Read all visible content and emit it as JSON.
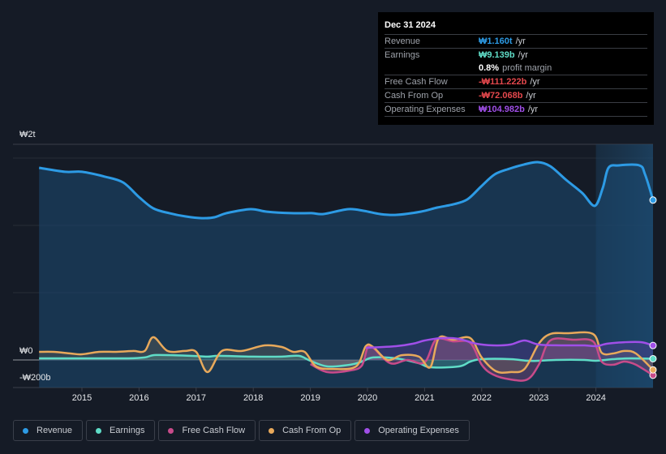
{
  "tooltip": {
    "date": "Dec 31 2024",
    "rows": [
      {
        "label": "Revenue",
        "value": "₩1.160t",
        "unit": "/yr",
        "color": "#2d9be5"
      },
      {
        "label": "Earnings",
        "value": "₩9.139b",
        "unit": "/yr",
        "color": "#5fdcc7"
      },
      {
        "label": "",
        "value": "0.8%",
        "unit": "profit margin",
        "color": "#ffffff"
      },
      {
        "label": "Free Cash Flow",
        "value": "-₩111.222b",
        "unit": "/yr",
        "color": "#e5484d"
      },
      {
        "label": "Cash From Op",
        "value": "-₩72.068b",
        "unit": "/yr",
        "color": "#e5484d"
      },
      {
        "label": "Operating Expenses",
        "value": "₩104.982b",
        "unit": "/yr",
        "color": "#a04fe8"
      }
    ]
  },
  "legend": [
    {
      "label": "Revenue",
      "color": "#2d9be5"
    },
    {
      "label": "Earnings",
      "color": "#5fdcc7"
    },
    {
      "label": "Free Cash Flow",
      "color": "#c84b8a"
    },
    {
      "label": "Cash From Op",
      "color": "#e8a95b"
    },
    {
      "label": "Operating Expenses",
      "color": "#a04fe8"
    }
  ],
  "chart_data": {
    "type": "line",
    "title": "",
    "xlabel": "",
    "ylabel": "",
    "units": "KRW billions",
    "y_tick_labels": [
      "₩2t",
      "₩0",
      "-₩200b"
    ],
    "x_tick_labels": [
      "2015",
      "2016",
      "2017",
      "2018",
      "2019",
      "2020",
      "2021",
      "2022",
      "2023",
      "2024"
    ],
    "xlim": [
      2014.25,
      2025.0
    ],
    "forecast_shade_from": 2024.0,
    "series": [
      {
        "name": "Revenue",
        "color": "#2d9be5",
        "points": [
          [
            2014.25,
            1394
          ],
          [
            2014.7,
            1365
          ],
          [
            2015.0,
            1365
          ],
          [
            2015.4,
            1330
          ],
          [
            2015.72,
            1288
          ],
          [
            2016.0,
            1182
          ],
          [
            2016.25,
            1100
          ],
          [
            2016.53,
            1065
          ],
          [
            2016.82,
            1041
          ],
          [
            2017.1,
            1029
          ],
          [
            2017.32,
            1035
          ],
          [
            2017.53,
            1065
          ],
          [
            2017.95,
            1094
          ],
          [
            2018.24,
            1076
          ],
          [
            2018.66,
            1065
          ],
          [
            2019.02,
            1065
          ],
          [
            2019.23,
            1059
          ],
          [
            2019.66,
            1094
          ],
          [
            2019.94,
            1082
          ],
          [
            2020.22,
            1059
          ],
          [
            2020.51,
            1053
          ],
          [
            2020.93,
            1076
          ],
          [
            2021.22,
            1106
          ],
          [
            2021.5,
            1129
          ],
          [
            2021.75,
            1165
          ],
          [
            2021.99,
            1259
          ],
          [
            2022.23,
            1347
          ],
          [
            2022.49,
            1388
          ],
          [
            2022.74,
            1418
          ],
          [
            2022.98,
            1435
          ],
          [
            2023.2,
            1406
          ],
          [
            2023.48,
            1306
          ],
          [
            2023.76,
            1212
          ],
          [
            2023.98,
            1118
          ],
          [
            2024.12,
            1247
          ],
          [
            2024.22,
            1394
          ],
          [
            2024.4,
            1412
          ],
          [
            2024.76,
            1412
          ],
          [
            2024.86,
            1347
          ],
          [
            2025.0,
            1160
          ]
        ]
      },
      {
        "name": "Earnings",
        "color": "#5fdcc7",
        "points": [
          [
            2014.25,
            12
          ],
          [
            2015.0,
            12
          ],
          [
            2015.8,
            12
          ],
          [
            2016.1,
            18
          ],
          [
            2016.3,
            36
          ],
          [
            2016.9,
            30
          ],
          [
            2017.2,
            24
          ],
          [
            2017.4,
            30
          ],
          [
            2018.0,
            24
          ],
          [
            2018.5,
            24
          ],
          [
            2018.8,
            30
          ],
          [
            2019.0,
            -6
          ],
          [
            2019.3,
            -47
          ],
          [
            2019.7,
            -35
          ],
          [
            2019.9,
            -12
          ],
          [
            2020.1,
            18
          ],
          [
            2020.5,
            12
          ],
          [
            2020.9,
            -24
          ],
          [
            2021.1,
            -53
          ],
          [
            2021.6,
            -47
          ],
          [
            2021.8,
            -12
          ],
          [
            2022.0,
            6
          ],
          [
            2022.5,
            6
          ],
          [
            2022.8,
            -6
          ],
          [
            2023.0,
            -6
          ],
          [
            2023.3,
            0
          ],
          [
            2023.8,
            0
          ],
          [
            2024.0,
            -6
          ],
          [
            2024.3,
            6
          ],
          [
            2024.6,
            12
          ],
          [
            2025.0,
            9
          ]
        ]
      },
      {
        "name": "Free Cash Flow",
        "color": "#c84b8a",
        "points": [
          [
            2019.0,
            -30
          ],
          [
            2019.3,
            -88
          ],
          [
            2019.7,
            -76
          ],
          [
            2019.9,
            -41
          ],
          [
            2020.0,
            88
          ],
          [
            2020.1,
            88
          ],
          [
            2020.4,
            -24
          ],
          [
            2020.7,
            0
          ],
          [
            2021.0,
            -18
          ],
          [
            2021.2,
            147
          ],
          [
            2021.5,
            135
          ],
          [
            2021.8,
            124
          ],
          [
            2022.0,
            -35
          ],
          [
            2022.2,
            -106
          ],
          [
            2022.5,
            -141
          ],
          [
            2022.8,
            -141
          ],
          [
            2023.0,
            -35
          ],
          [
            2023.2,
            141
          ],
          [
            2023.6,
            147
          ],
          [
            2023.95,
            135
          ],
          [
            2024.1,
            -12
          ],
          [
            2024.3,
            -35
          ],
          [
            2024.5,
            -12
          ],
          [
            2024.7,
            -35
          ],
          [
            2025.0,
            -111
          ]
        ]
      },
      {
        "name": "Cash From Op",
        "color": "#e8a95b",
        "points": [
          [
            2014.25,
            59
          ],
          [
            2014.5,
            59
          ],
          [
            2014.8,
            47
          ],
          [
            2015.0,
            41
          ],
          [
            2015.3,
            59
          ],
          [
            2015.6,
            59
          ],
          [
            2015.9,
            65
          ],
          [
            2016.1,
            65
          ],
          [
            2016.25,
            165
          ],
          [
            2016.5,
            65
          ],
          [
            2016.8,
            65
          ],
          [
            2017.0,
            59
          ],
          [
            2017.2,
            -88
          ],
          [
            2017.45,
            65
          ],
          [
            2017.8,
            65
          ],
          [
            2018.2,
            106
          ],
          [
            2018.5,
            94
          ],
          [
            2018.7,
            59
          ],
          [
            2018.9,
            59
          ],
          [
            2019.1,
            -47
          ],
          [
            2019.4,
            -65
          ],
          [
            2019.8,
            -47
          ],
          [
            2019.97,
            100
          ],
          [
            2020.1,
            94
          ],
          [
            2020.35,
            0
          ],
          [
            2020.6,
            35
          ],
          [
            2020.9,
            24
          ],
          [
            2021.1,
            -53
          ],
          [
            2021.25,
            159
          ],
          [
            2021.5,
            147
          ],
          [
            2021.8,
            159
          ],
          [
            2022.0,
            18
          ],
          [
            2022.25,
            -82
          ],
          [
            2022.5,
            -88
          ],
          [
            2022.75,
            -65
          ],
          [
            2023.0,
            118
          ],
          [
            2023.2,
            188
          ],
          [
            2023.5,
            194
          ],
          [
            2023.95,
            188
          ],
          [
            2024.1,
            53
          ],
          [
            2024.3,
            47
          ],
          [
            2024.5,
            65
          ],
          [
            2024.7,
            47
          ],
          [
            2025.0,
            -72
          ]
        ]
      },
      {
        "name": "Operating Expenses",
        "color": "#a04fe8",
        "points": [
          [
            2019.97,
            88
          ],
          [
            2020.5,
            100
          ],
          [
            2020.8,
            118
          ],
          [
            2021.0,
            141
          ],
          [
            2021.3,
            159
          ],
          [
            2021.6,
            153
          ],
          [
            2021.9,
            118
          ],
          [
            2022.2,
            106
          ],
          [
            2022.5,
            112
          ],
          [
            2022.75,
            141
          ],
          [
            2023.0,
            112
          ],
          [
            2023.4,
            106
          ],
          [
            2023.8,
            106
          ],
          [
            2024.0,
            100
          ],
          [
            2024.2,
            118
          ],
          [
            2024.5,
            129
          ],
          [
            2024.8,
            129
          ],
          [
            2025.0,
            105
          ]
        ]
      }
    ]
  }
}
